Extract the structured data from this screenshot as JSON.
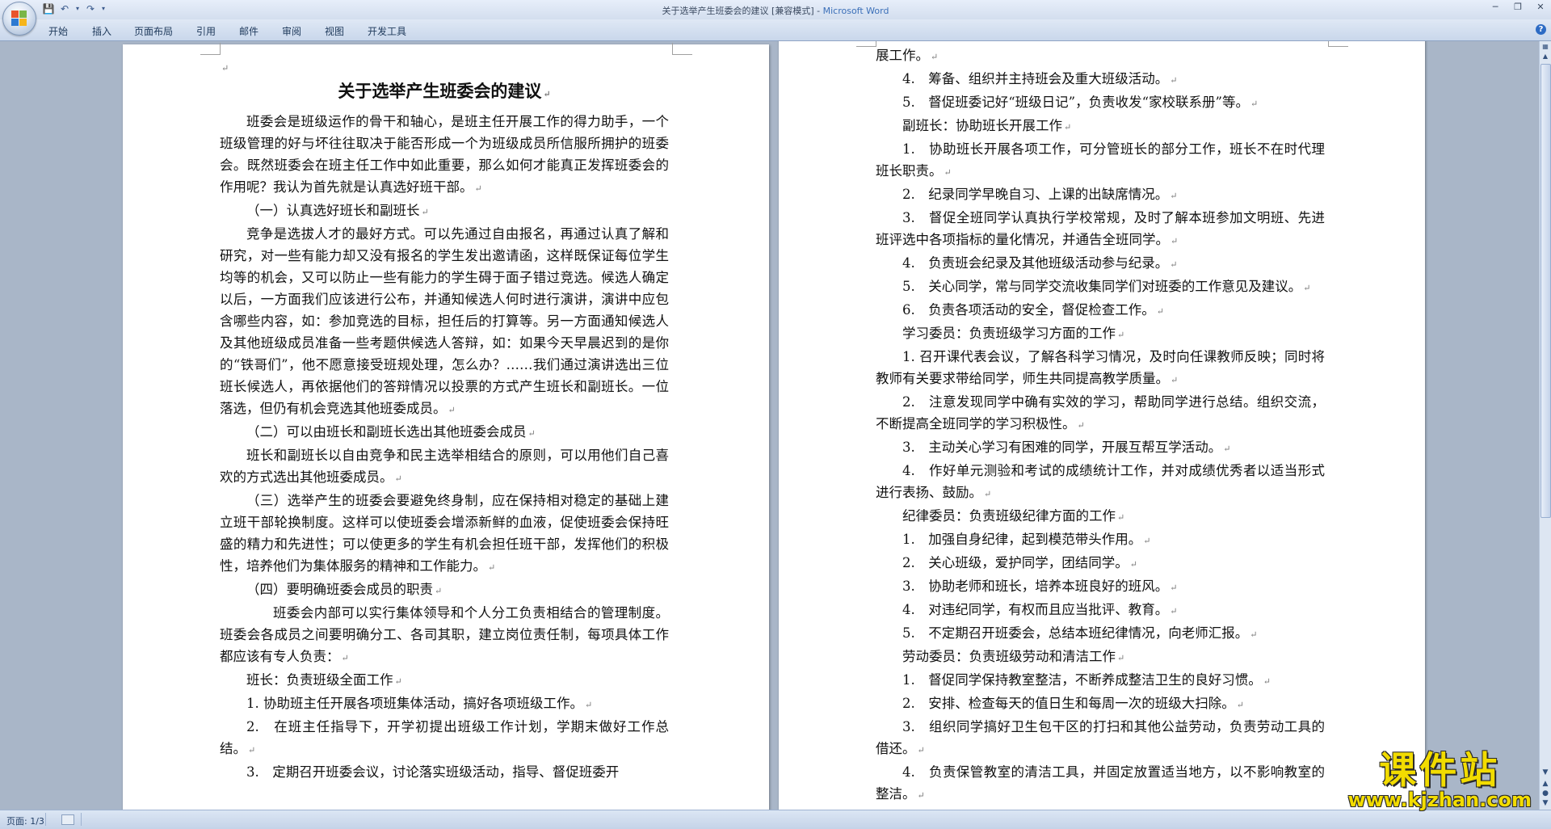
{
  "window": {
    "title_doc": "关于选举产生班委会的建议 [兼容模式]",
    "title_sep": " - ",
    "title_app": "Microsoft Word"
  },
  "ribbon": {
    "tabs": [
      "开始",
      "插入",
      "页面布局",
      "引用",
      "邮件",
      "审阅",
      "视图",
      "开发工具"
    ]
  },
  "left_page": {
    "title": "关于选举产生班委会的建议",
    "paragraphs": [
      "班委会是班级运作的骨干和轴心，是班主任开展工作的得力助手，一个班级管理的好与坏往往取决于能否形成一个为班级成员所信服所拥护的班委会。既然班委会在班主任工作中如此重要，那么如何才能真正发挥班委会的作用呢？我认为首先就是认真选好班干部。",
      "（一）认真选好班长和副班长",
      "竞争是选拔人才的最好方式。可以先通过自由报名，再通过认真了解和研究，对一些有能力却又没有报名的学生发出邀请函，这样既保证每位学生均等的机会，又可以防止一些有能力的学生碍于面子错过竞选。候选人确定以后，一方面我们应该进行公布，并通知候选人何时进行演讲，演讲中应包含哪些内容，如：参加竞选的目标，担任后的打算等。另一方面通知候选人及其他班级成员准备一些考题供候选人答辩，如：如果今天早晨迟到的是你的“铁哥们”，他不愿意接受班规处理，怎么办？……我们通过演讲选出三位班长候选人，再依据他们的答辩情况以投票的方式产生班长和副班长。一位落选，但仍有机会竞选其他班委成员。",
      "（二）可以由班长和副班长选出其他班委会成员",
      "班长和副班长以自由竞争和民主选举相结合的原则，可以用他们自己喜欢的方式选出其他班委成员。",
      "（三）选举产生的班委会要避免终身制，应在保持相对稳定的基础上建立班干部轮换制度。这样可以使班委会增添新鲜的血液，促使班委会保持旺盛的精力和先进性；可以使更多的学生有机会担任班干部，发挥他们的积极性，培养他们为集体服务的精神和工作能力。",
      "（四）要明确班委会成员的职责",
      "班委会内部可以实行集体领导和个人分工负责相结合的管理制度。班委会各成员之间要明确分工、各司其职，建立岗位责任制，每项具体工作都应该有专人负责：",
      "班长：负责班级全面工作",
      "1. 协助班主任开展各项班集体活动，搞好各项班级工作。",
      "2.　在班主任指导下，开学初提出班级工作计划，学期末做好工作总结。",
      "3.　定期召开班委会议，讨论落实班级活动，指导、督促班委开"
    ]
  },
  "right_page": {
    "paragraphs": [
      "展工作。",
      "4.　筹备、组织并主持班会及重大班级活动。",
      "5.　督促班委记好“班级日记”，负责收发“家校联系册”等。",
      "副班长：协助班长开展工作",
      "1.　协助班长开展各项工作，可分管班长的部分工作，班长不在时代理班长职责。",
      "2.　纪录同学早晚自习、上课的出缺席情况。",
      "3.　督促全班同学认真执行学校常规，及时了解本班参加文明班、先进班评选中各项指标的量化情况，并通告全班同学。",
      "4.　负责班会纪录及其他班级活动参与纪录。",
      "5.　关心同学，常与同学交流收集同学们对班委的工作意见及建议。",
      "6.　负责各项活动的安全，督促检查工作。",
      "学习委员：负责班级学习方面的工作",
      "1. 召开课代表会议，了解各科学习情况，及时向任课教师反映；同时将教师有关要求带给同学，师生共同提高教学质量。",
      "2.　注意发现同学中确有实效的学习，帮助同学进行总结。组织交流，不断提高全班同学的学习积极性。",
      "3.　主动关心学习有困难的同学，开展互帮互学活动。",
      "4.　作好单元测验和考试的成绩统计工作，并对成绩优秀者以适当形式进行表扬、鼓励。",
      "纪律委员：负责班级纪律方面的工作",
      "1.　加强自身纪律，起到模范带头作用。",
      "2.　关心班级，爱护同学，团结同学。",
      "3.　协助老师和班长，培养本班良好的班风。",
      "4.　对违纪同学，有权而且应当批评、教育。",
      "5.　不定期召开班委会，总结本班纪律情况，向老师汇报。",
      "劳动委员：负责班级劳动和清洁工作",
      "1.　督促同学保持教室整洁，不断养成整洁卫生的良好习惯。",
      "2.　安排、检查每天的值日生和每周一次的班级大扫除。",
      "3.　组织同学搞好卫生包干区的打扫和其他公益劳动，负责劳动工具的借还。",
      "4.　负责保管教室的清洁工具，并固定放置适当地方，以不影响教室的整洁。"
    ]
  },
  "status": {
    "page": "页面: 1/3"
  },
  "watermark": {
    "title": "课件站",
    "url": "www.kjzhan.com"
  }
}
